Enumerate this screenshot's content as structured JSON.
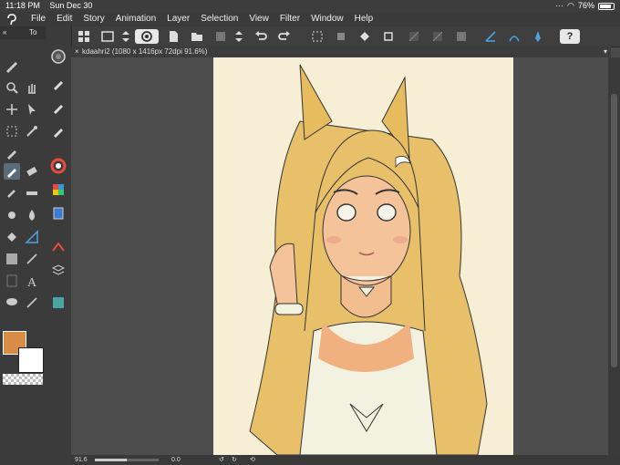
{
  "status_bar": {
    "time": "11:18 PM",
    "date": "Sun Dec 30",
    "battery": "76%",
    "battery_level": 0.76
  },
  "menu": [
    "File",
    "Edit",
    "Story",
    "Animation",
    "Layer",
    "Selection",
    "View",
    "Filter",
    "Window",
    "Help"
  ],
  "tool_panel": {
    "header": "To"
  },
  "document": {
    "title": "kdaahri2 (1080 x 1416px 72dpi 91.6%)"
  },
  "bottom_bar": {
    "zoom": "91.6",
    "angle": "0.0"
  },
  "colors": {
    "main": "#d98c45",
    "sub": "#ffffff",
    "accent": "#5a6b7a"
  },
  "help_label": "?"
}
